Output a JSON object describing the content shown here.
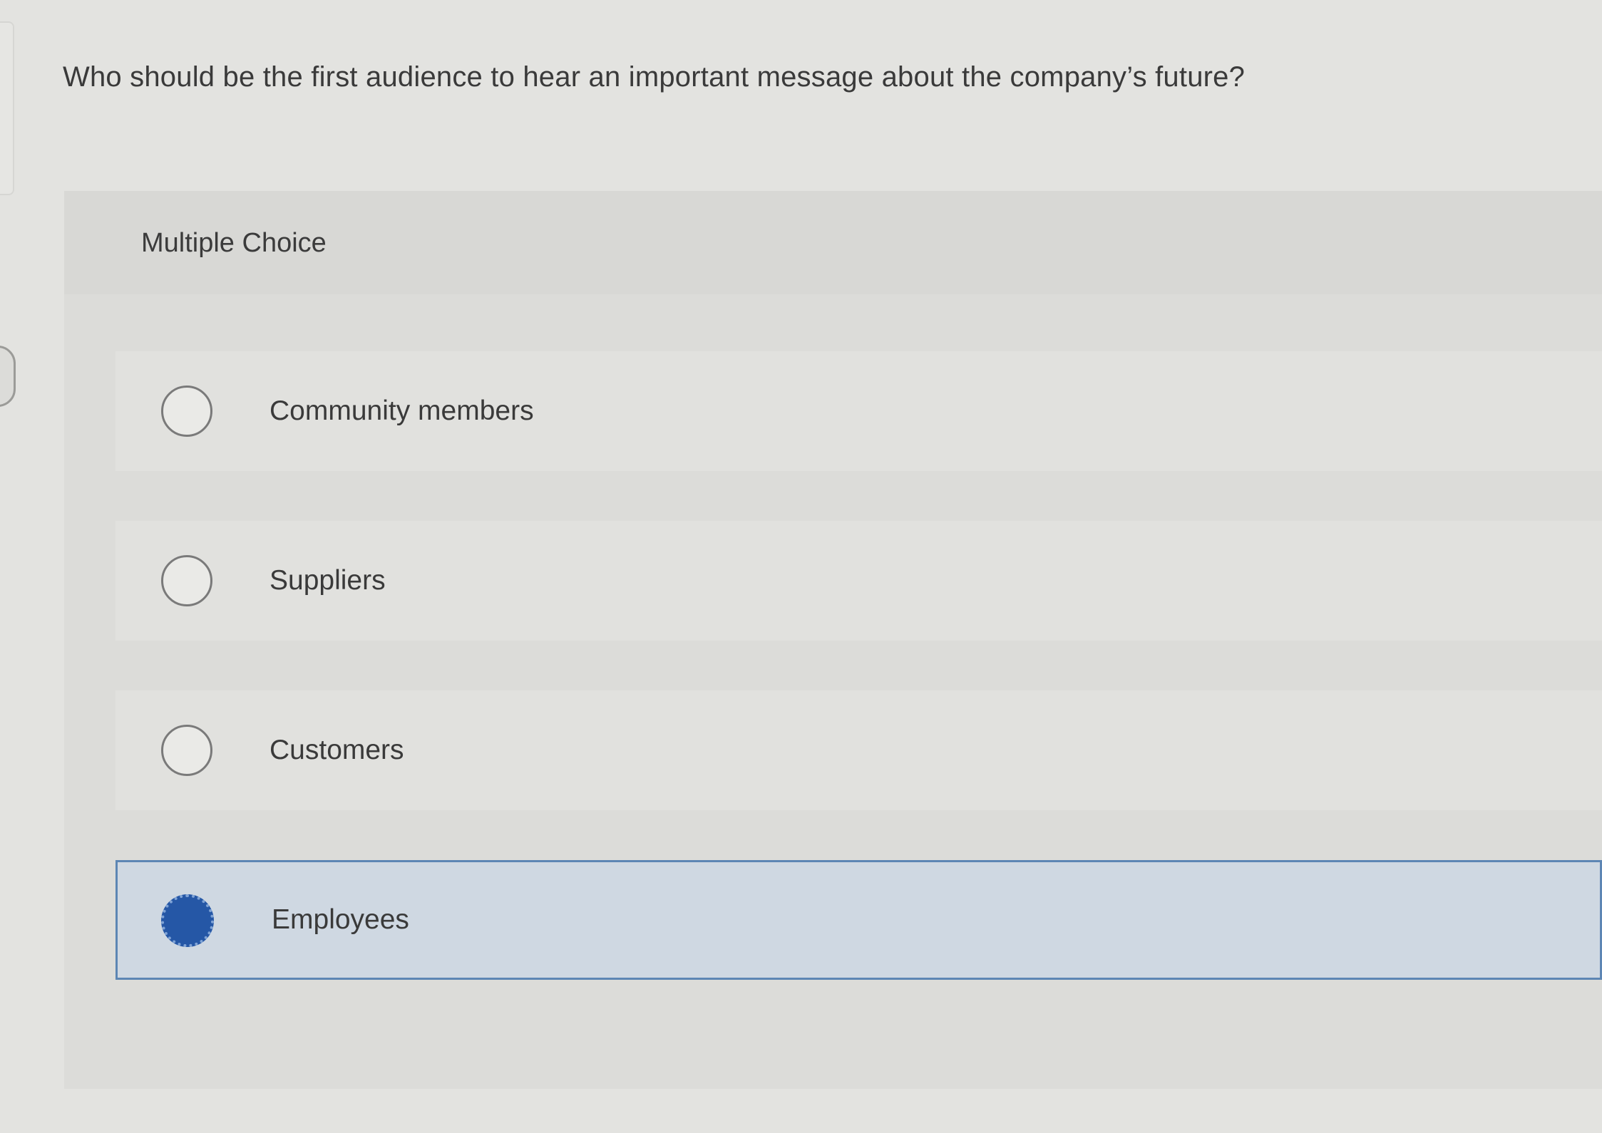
{
  "question": {
    "text": "Who should be the first audience to hear an important message about the company’s future?"
  },
  "panel": {
    "title": "Multiple Choice"
  },
  "options": [
    {
      "label": "Community members",
      "selected": false
    },
    {
      "label": "Suppliers",
      "selected": false
    },
    {
      "label": "Customers",
      "selected": false
    },
    {
      "label": "Employees",
      "selected": true
    }
  ],
  "colors": {
    "selected_fill": "#2557a6",
    "selected_border": "#5d86b4",
    "selected_background": "#cfd8e2"
  },
  "icons": {
    "unselected_radio": "radio-unselected-icon",
    "selected_radio": "radio-selected-icon"
  }
}
